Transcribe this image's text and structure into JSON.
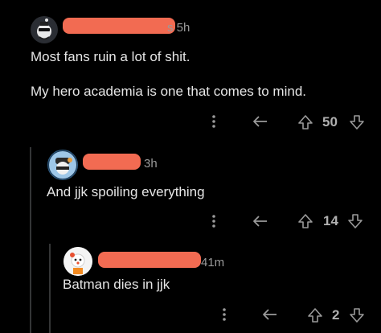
{
  "comments": [
    {
      "time": "s 5h",
      "lines": [
        "Most fans ruin a lot of shit.",
        "My hero academia is one that comes to mind."
      ],
      "score": "50"
    },
    {
      "time": "3h",
      "lines": [
        "And jjk spoiling everything"
      ],
      "score": "14"
    },
    {
      "time": "41m",
      "lines": [
        "Batman dies in jjk"
      ],
      "score": "2"
    }
  ],
  "colors": {
    "background": "#000000",
    "redaction": "#f26b52",
    "thread_line": "#343536",
    "meta_text": "#9a9a9a"
  },
  "icons": [
    "more-vertical-icon",
    "reply-icon",
    "upvote-icon",
    "downvote-icon"
  ]
}
